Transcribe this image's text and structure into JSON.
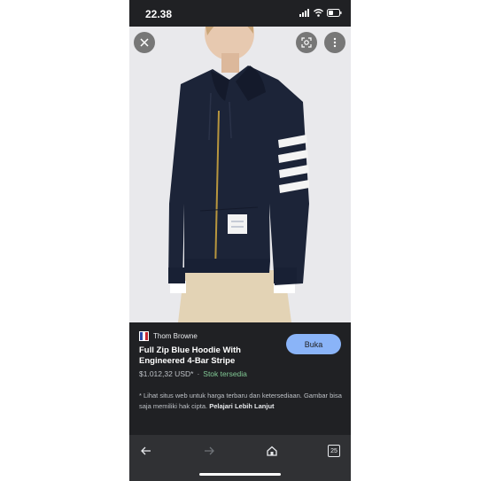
{
  "status_bar": {
    "time": "22.38"
  },
  "product": {
    "brand": "Thom Browne",
    "title": "Full Zip Blue Hoodie With Engineered 4-Bar Stripe",
    "price": "$1.012,32 USD*",
    "separator": "·",
    "stock": "Stok tersedia",
    "visit_button": "Buka"
  },
  "disclaimer": {
    "text": "* Lihat situs web untuk harga terbaru dan ketersediaan. Gambar bisa saja memiliki hak cipta.",
    "link": "Pelajari Lebih Lanjut"
  },
  "nav": {
    "tab_count": "25"
  },
  "colors": {
    "background": "#202124",
    "accent": "#8ab4f8",
    "stock": "#81c995",
    "hoodie": "#1c2438"
  },
  "icons": [
    "close-icon",
    "lens-icon",
    "more-vert-icon",
    "back-arrow-icon",
    "forward-arrow-icon",
    "home-icon",
    "tabs-icon"
  ]
}
